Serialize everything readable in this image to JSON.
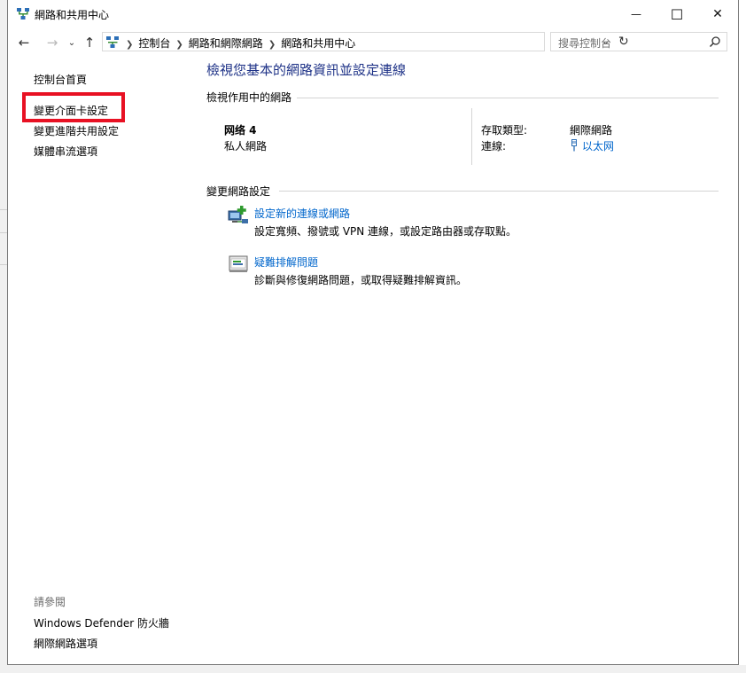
{
  "window": {
    "title": "網路和共用中心",
    "controls": {
      "minimize": "—",
      "maximize": "☐",
      "close": "✕"
    }
  },
  "nav": {
    "back_icon": "back-arrow-icon",
    "forward_icon": "forward-arrow-icon",
    "recent_icon": "chevron-down-icon",
    "up_icon": "up-arrow-icon"
  },
  "address": {
    "crumbs": [
      "控制台",
      "網路和網際網路",
      "網路和共用中心"
    ]
  },
  "search": {
    "placeholder": "搜尋控制台"
  },
  "sidebar": {
    "home": "控制台首頁",
    "links": [
      "變更介面卡設定",
      "變更進階共用設定",
      "媒體串流選項"
    ],
    "see_also_label": "請參閱",
    "see_also": [
      "Windows Defender 防火牆",
      "網際網路選項"
    ]
  },
  "main": {
    "title": "檢視您基本的網路資訊並設定連線",
    "active_header": "檢視作用中的網路",
    "network": {
      "name": "网络 4",
      "category": "私人網路",
      "access_type_label": "存取類型:",
      "access_type_value": "網際網路",
      "connection_label": "連線:",
      "connection_value": "以太网"
    },
    "change_header": "變更網路設定",
    "tasks": [
      {
        "link": "設定新的連線或網路",
        "desc": "設定寬頻、撥號或 VPN 連線，或設定路由器或存取點。"
      },
      {
        "link": "疑難排解問題",
        "desc": "診斷與修復網路問題，或取得疑難排解資訊。"
      }
    ]
  },
  "colors": {
    "highlight": "#e81123",
    "link": "#0066cc",
    "title": "#1e3287"
  }
}
